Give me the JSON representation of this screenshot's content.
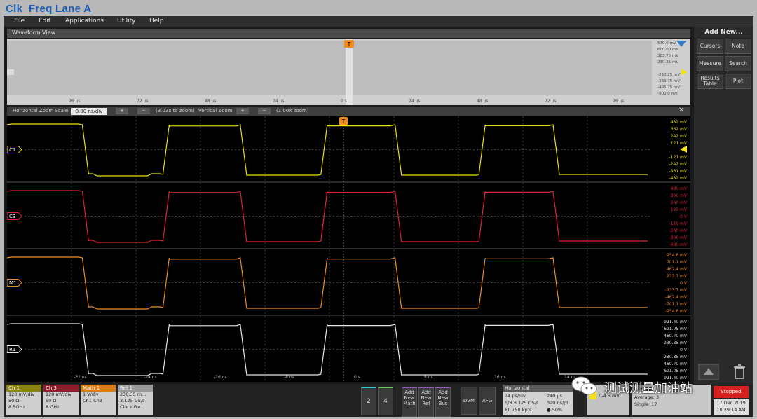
{
  "window": {
    "title": "Clk_Freq Lane A"
  },
  "menu": [
    "File",
    "Edit",
    "Applications",
    "Utility",
    "Help"
  ],
  "waveform_view": {
    "label": "Waveform View"
  },
  "overview": {
    "time_ticks": [
      "96 µs",
      "72 µs",
      "48 µs",
      "24 µs",
      "0 s",
      "24 µs",
      "48 µs",
      "72 µs",
      "96 µs"
    ],
    "y_labels": [
      "570.0 mV",
      "600.00 mV",
      "383.75 mV",
      "230.25 mV",
      "",
      "-230.25 mV",
      "-383.75 mV",
      "-495.75 mV",
      "-900.0 mV"
    ]
  },
  "zoom": {
    "horizontal_label": "Horizontal Zoom Scale",
    "horizontal_value": "8.00 ns/div",
    "horizontal_factor": "(3.03x to zoom)",
    "vertical_label": "Vertical Zoom",
    "vertical_factor": "(1.00x zoom)",
    "plus": "+",
    "minus": "−",
    "close": "✕"
  },
  "trigger_marker": "T",
  "channels": [
    {
      "id": "C1",
      "color": "#e8e20b",
      "y_labels": [
        "482 mV",
        "362 mV",
        "242 mV",
        "121 mV",
        "",
        "-121 mV",
        "-242 mV",
        "-361 mV",
        "-482 mV"
      ]
    },
    {
      "id": "C3",
      "color": "#e0223a",
      "y_labels": [
        "480 mV",
        "360 mV",
        "240 mV",
        "120 mV",
        "0 V",
        "-120 mV",
        "-240 mV",
        "-360 mV",
        "-480 mV"
      ]
    },
    {
      "id": "M1",
      "color": "#f08c1e",
      "y_labels": [
        "934.8 mV",
        "701.1 mV",
        "467.4 mV",
        "233.7 mV",
        "0 V",
        "-233.7 mV",
        "-467.4 mV",
        "-701.1 mV",
        "-934.8 mV"
      ]
    },
    {
      "id": "R1",
      "color": "#e6e6e6",
      "y_labels": [
        "921.40 mV",
        "691.05 mV",
        "460.70 mV",
        "230.35 mV",
        "0 V",
        "-230.35 mV",
        "-460.70 mV",
        "-691.05 mV",
        "-921.40 mV"
      ]
    }
  ],
  "time_axis": [
    "-32 ns",
    "-24 ns",
    "-16 ns",
    "-8 ns",
    "0 s",
    "8 ns",
    "16 ns",
    "24 ns"
  ],
  "sidebar": {
    "title": "Add New...",
    "buttons": [
      "Cursors",
      "Note",
      "Measure",
      "Search",
      "Results Table",
      "Plot"
    ]
  },
  "bottom": {
    "ch1": {
      "title": "Ch 1",
      "lines": [
        "120 mV/div",
        "50 Ω",
        "8.5GHz"
      ],
      "color": "#8a8410"
    },
    "ch3": {
      "title": "Ch 3",
      "lines": [
        "120 mV/div",
        "50 Ω",
        "8 GHz"
      ],
      "color": "#8b1e2a"
    },
    "math1": {
      "title": "Math 1",
      "lines": [
        "1 V/div",
        "Ch1-Ch3"
      ],
      "color": "#d97b17"
    },
    "ref1": {
      "title": "Ref 1",
      "lines": [
        "230.35 m...",
        "3.125 GS/s",
        "Clock Fre..."
      ],
      "color": "#b7b7b7"
    },
    "btn2": "2",
    "btn4": "4",
    "add_math": "Add New Math",
    "add_ref": "Add New Ref",
    "add_bus": "Add New Bus",
    "dvm": "DVM",
    "afg": "AFG",
    "horizontal": {
      "title": "Horizontal",
      "l1": "24 ps/div",
      "l2": "S/R 3.125 GS/s",
      "l3": "RL 750 kpts",
      "r1": "240 µs",
      "r2": "320 ns/pt",
      "r3": "● 50%"
    },
    "trigger": {
      "value": "/ -4.6 mV"
    },
    "acq": {
      "title": "Manual",
      "t2": "Analyze",
      "l2": "Average: 3",
      "l3": "Single: 17"
    },
    "stop": "Stopped",
    "date": {
      "d": "17 Dec 2019",
      "t": "10:29:14 AM"
    }
  },
  "watermark": {
    "text": "测试测量加油站"
  }
}
